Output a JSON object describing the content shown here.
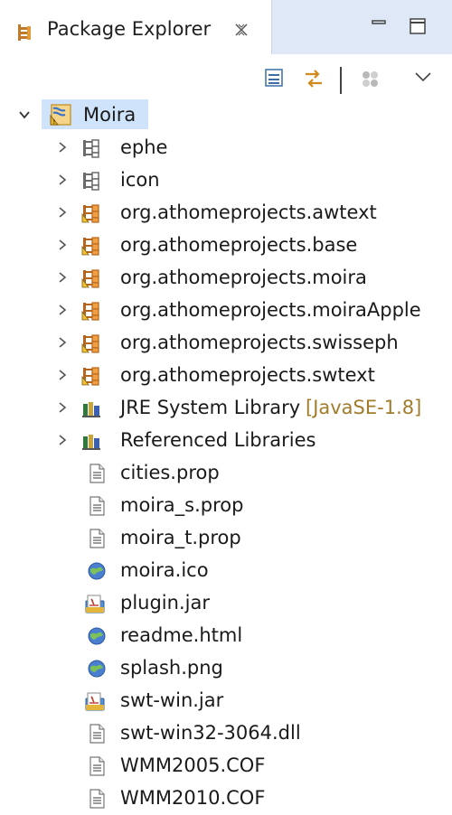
{
  "view": {
    "title": "Package Explorer",
    "tab_icon": "package-explorer-icon",
    "close_icon": "close-icon",
    "minimize_icon": "minimize-icon",
    "maximize_icon": "maximize-icon"
  },
  "toolbar": {
    "collapse_all_icon": "collapse-all-icon",
    "link_with_editor_icon": "link-with-editor-icon",
    "focus_icon": "focus-on-active-task-icon",
    "view_menu_icon": "view-menu-icon"
  },
  "colors": {
    "tab_strip": "#dfe8f6",
    "selection": "#cfe3fb",
    "package_orange": "#d9822b",
    "decoration": "#a07c2c"
  },
  "tree": {
    "project": {
      "label": "Moira",
      "icon": "java-project-icon",
      "expanded": true
    },
    "items": [
      {
        "label": "ephe",
        "icon": "source-folder-icon",
        "expandable": true
      },
      {
        "label": "icon",
        "icon": "source-folder-icon",
        "expandable": true
      },
      {
        "label": "org.athomeprojects.awtext",
        "icon": "package-warning-icon",
        "expandable": true
      },
      {
        "label": "org.athomeprojects.base",
        "icon": "package-warning-icon",
        "expandable": true
      },
      {
        "label": "org.athomeprojects.moira",
        "icon": "package-warning-icon",
        "expandable": true
      },
      {
        "label": "org.athomeprojects.moiraApple",
        "icon": "package-warning-icon",
        "expandable": true
      },
      {
        "label": "org.athomeprojects.swisseph",
        "icon": "package-warning-icon",
        "expandable": true
      },
      {
        "label": "org.athomeprojects.swtext",
        "icon": "package-warning-icon",
        "expandable": true
      },
      {
        "label": "JRE System Library",
        "decoration": "[JavaSE-1.8]",
        "icon": "library-icon",
        "expandable": true
      },
      {
        "label": "Referenced Libraries",
        "icon": "library-icon",
        "expandable": true
      },
      {
        "label": "cities.prop",
        "icon": "text-file-icon",
        "expandable": false
      },
      {
        "label": "moira_s.prop",
        "icon": "text-file-icon",
        "expandable": false
      },
      {
        "label": "moira_t.prop",
        "icon": "text-file-icon",
        "expandable": false
      },
      {
        "label": "moira.ico",
        "icon": "globe-file-icon",
        "expandable": false
      },
      {
        "label": "plugin.jar",
        "icon": "jar-file-icon",
        "expandable": false
      },
      {
        "label": "readme.html",
        "icon": "globe-file-icon",
        "expandable": false
      },
      {
        "label": "splash.png",
        "icon": "globe-file-icon",
        "expandable": false
      },
      {
        "label": "swt-win.jar",
        "icon": "jar-file-icon",
        "expandable": false
      },
      {
        "label": "swt-win32-3064.dll",
        "icon": "text-file-icon",
        "expandable": false
      },
      {
        "label": "WMM2005.COF",
        "icon": "text-file-icon",
        "expandable": false
      },
      {
        "label": "WMM2010.COF",
        "icon": "text-file-icon",
        "expandable": false
      }
    ]
  }
}
